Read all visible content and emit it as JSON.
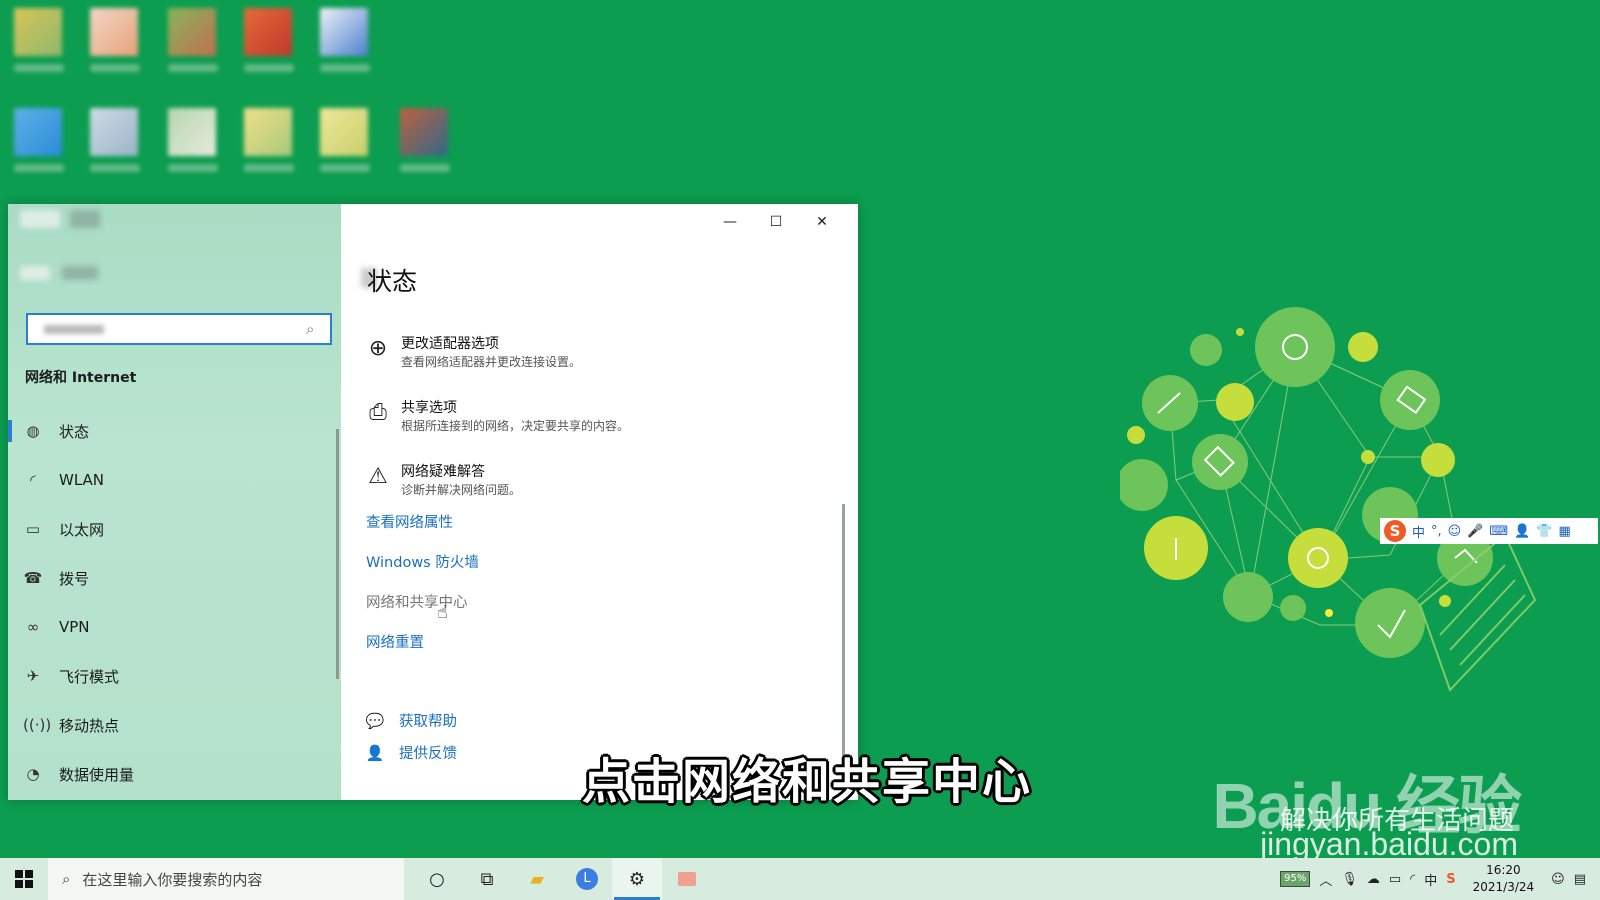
{
  "colors": {
    "desktop_bg": "#0c9d50",
    "accent": "#2a7fd4",
    "link": "#1a6fc4"
  },
  "sidebar": {
    "heading": "网络和 Internet",
    "items": [
      {
        "icon": "globe-status-icon",
        "label": "状态"
      },
      {
        "icon": "wifi-icon",
        "label": "WLAN"
      },
      {
        "icon": "ethernet-icon",
        "label": "以太网"
      },
      {
        "icon": "dialup-icon",
        "label": "拨号"
      },
      {
        "icon": "vpn-icon",
        "label": "VPN"
      },
      {
        "icon": "airplane-icon",
        "label": "飞行模式"
      },
      {
        "icon": "hotspot-icon",
        "label": "移动热点"
      },
      {
        "icon": "data-usage-icon",
        "label": "数据使用量"
      }
    ]
  },
  "window_controls": {
    "minimize": "—",
    "maximize": "☐",
    "close": "✕"
  },
  "main": {
    "title": "状态",
    "options": [
      {
        "icon": "adapter-icon",
        "title": "更改适配器选项",
        "desc": "查看网络适配器并更改连接设置。"
      },
      {
        "icon": "sharing-icon",
        "title": "共享选项",
        "desc": "根据所连接到的网络，决定要共享的内容。"
      },
      {
        "icon": "warning-icon",
        "title": "网络疑难解答",
        "desc": "诊断并解决网络问题。"
      }
    ],
    "links": [
      "查看网络属性",
      "Windows 防火墙",
      "网络和共享中心",
      "网络重置"
    ],
    "help": [
      {
        "icon": "help-icon",
        "label": "获取帮助"
      },
      {
        "icon": "feedback-icon",
        "label": "提供反馈"
      }
    ]
  },
  "overlay": {
    "subtitle": "点击网络和共享中心",
    "watermark_logo": "Baidu 经验",
    "watermark_slogan": "解决你所有生活问题",
    "watermark_url": "jingyan.baidu.com"
  },
  "ime": {
    "logo": "S",
    "mode": "中",
    "punct": "°,",
    "items": [
      "☺",
      "🎤",
      "⌨",
      "👤",
      "👕",
      "▦"
    ]
  },
  "taskbar": {
    "search_placeholder": "在这里输入你要搜索的内容",
    "apps": [
      "cortana-icon",
      "task-view-icon",
      "file-explorer-icon",
      "browser-icon",
      "settings-icon",
      "media-app-icon"
    ],
    "battery": "95%",
    "ime_indicator": "中",
    "time": "16:20",
    "date": "2021/3/24"
  }
}
